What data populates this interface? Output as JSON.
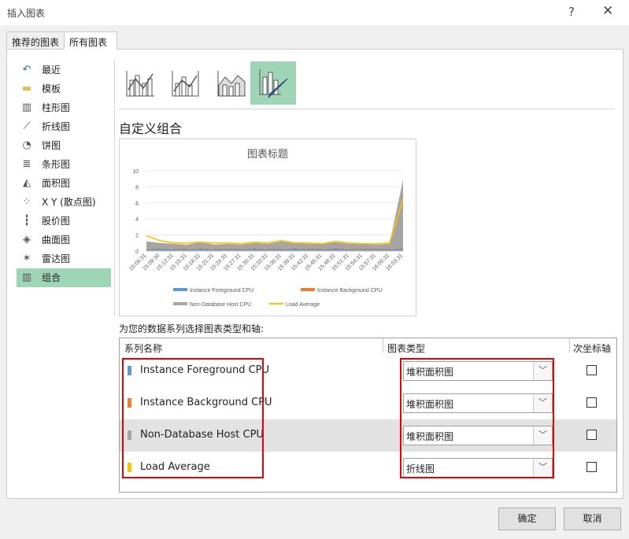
{
  "window": {
    "title": "插入图表",
    "help_label": "?",
    "close_label": "✕"
  },
  "tabs": [
    {
      "label": "推荐的图表"
    },
    {
      "label": "所有图表"
    }
  ],
  "sidebar": {
    "items": [
      {
        "label": "最近",
        "icon": "recent-icon"
      },
      {
        "label": "模板",
        "icon": "folder-icon"
      },
      {
        "label": "柱形图",
        "icon": "column-chart-icon"
      },
      {
        "label": "折线图",
        "icon": "line-chart-icon"
      },
      {
        "label": "饼图",
        "icon": "pie-chart-icon"
      },
      {
        "label": "条形图",
        "icon": "bar-chart-icon"
      },
      {
        "label": "面积图",
        "icon": "area-chart-icon"
      },
      {
        "label": "X Y (散点图)",
        "icon": "scatter-chart-icon"
      },
      {
        "label": "股价图",
        "icon": "stock-chart-icon"
      },
      {
        "label": "曲面图",
        "icon": "surface-chart-icon"
      },
      {
        "label": "雷达图",
        "icon": "radar-chart-icon"
      },
      {
        "label": "组合",
        "icon": "combo-chart-icon"
      }
    ],
    "selected": "组合"
  },
  "combo_title": "自定义组合",
  "chart_data": {
    "type": "area",
    "title": "图表标题",
    "ylim": [
      0,
      10
    ],
    "yticks": [
      "0",
      "2",
      "4",
      "6",
      "8",
      "10"
    ],
    "categories": [
      "15:06:31",
      "15:09:30",
      "15:12:31",
      "15:15:31",
      "15:18:31",
      "15:21:31",
      "15:24:31",
      "15:27:31",
      "15:30:31",
      "15:33:31",
      "15:36:31",
      "15:39:31",
      "15:42:31",
      "15:45:31",
      "15:48:31",
      "15:51:31",
      "15:54:31",
      "15:57:31",
      "16:00:31",
      "16:03:31"
    ],
    "series": [
      {
        "name": "Instance Foreground CPU",
        "color": "#5b9bd5",
        "values": [
          0.2,
          0.3,
          0.2,
          0.2,
          0.3,
          0.2,
          0.2,
          0.2,
          0.3,
          0.2,
          0.2,
          0.3,
          0.2,
          0.2,
          0.3,
          0.2,
          0.2,
          0.2,
          0.2,
          0.3
        ]
      },
      {
        "name": "Instance Background CPU",
        "color": "#ed7d31",
        "values": [
          0.1,
          0.1,
          0.1,
          0.1,
          0.1,
          0.1,
          0.1,
          0.1,
          0.1,
          0.1,
          0.1,
          0.1,
          0.1,
          0.1,
          0.1,
          0.1,
          0.1,
          0.1,
          0.1,
          0.1
        ]
      },
      {
        "name": "Non-Database Host CPU",
        "color": "#a5a5a5",
        "values": [
          0.9,
          0.6,
          0.6,
          0.5,
          0.7,
          0.5,
          0.6,
          0.5,
          0.6,
          0.6,
          0.9,
          0.6,
          0.6,
          0.6,
          0.7,
          0.6,
          0.6,
          0.5,
          0.6,
          8.5
        ]
      },
      {
        "name": "Load Average",
        "color": "#ffc000",
        "values": [
          1.9,
          1.3,
          1.0,
          1.0,
          1.1,
          1.0,
          1.0,
          0.9,
          1.1,
          1.0,
          1.3,
          1.0,
          1.0,
          0.9,
          1.2,
          1.0,
          0.9,
          0.9,
          1.0,
          6.5
        ]
      }
    ]
  },
  "assign_label": "为您的数据系列选择图表类型和轴:",
  "table": {
    "headers": {
      "name": "系列名称",
      "type": "图表类型",
      "axis": "次坐标轴"
    },
    "rows": [
      {
        "name": "Instance Foreground CPU",
        "color": "#5b9bd5",
        "type": "堆积面积图",
        "secondary": false
      },
      {
        "name": "Instance Background CPU",
        "color": "#ed7d31",
        "type": "堆积面积图",
        "secondary": false
      },
      {
        "name": "Non-Database Host CPU",
        "color": "#a5a5a5",
        "type": "堆积面积图",
        "secondary": false
      },
      {
        "name": "Load Average",
        "color": "#ffc000",
        "type": "折线图",
        "secondary": false
      }
    ],
    "highlighted_row": 2,
    "dropdown_glyph": "﹀"
  },
  "buttons": {
    "ok": "确定",
    "cancel": "取消"
  }
}
